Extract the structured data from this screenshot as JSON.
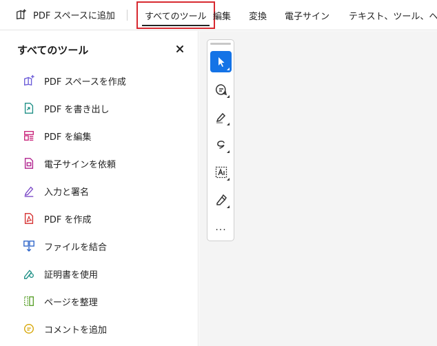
{
  "topbar": {
    "add_space_label": "PDF スペースに追加",
    "tabs": [
      {
        "label": "すべてのツール"
      },
      {
        "label": "編集"
      },
      {
        "label": "変換"
      },
      {
        "label": "電子サイン"
      },
      {
        "label": "テキスト、ツール、ヘルプ"
      }
    ],
    "highlight_color": "#d7282f"
  },
  "panel": {
    "title": "すべてのツール",
    "close_icon": "close-icon",
    "items": [
      {
        "label": "PDF スペースを作成",
        "icon": "pdf-space-create-icon",
        "color": "#6b5bd8"
      },
      {
        "label": "PDF を書き出し",
        "icon": "export-pdf-icon",
        "color": "#1d8f85"
      },
      {
        "label": "PDF を編集",
        "icon": "edit-pdf-icon",
        "color": "#c9237a"
      },
      {
        "label": "電子サインを依頼",
        "icon": "request-signature-icon",
        "color": "#b0238e"
      },
      {
        "label": "入力と署名",
        "icon": "fill-sign-icon",
        "color": "#7b49c7"
      },
      {
        "label": "PDF を作成",
        "icon": "create-pdf-icon",
        "color": "#d42d2d"
      },
      {
        "label": "ファイルを結合",
        "icon": "combine-files-icon",
        "color": "#2a62c8"
      },
      {
        "label": "証明書を使用",
        "icon": "certificate-icon",
        "color": "#1d8f85"
      },
      {
        "label": "ページを整理",
        "icon": "organize-pages-icon",
        "color": "#5aa02c"
      },
      {
        "label": "コメントを追加",
        "icon": "add-comment-icon",
        "color": "#d6a400"
      }
    ]
  },
  "quick_tools": {
    "selected_color": "#1473e6",
    "buttons": [
      {
        "icon": "select-cursor-icon"
      },
      {
        "icon": "comment-icon"
      },
      {
        "icon": "highlight-pen-icon"
      },
      {
        "icon": "freehand-draw-icon"
      },
      {
        "icon": "text-recognize-icon"
      },
      {
        "icon": "sign-pen-icon"
      },
      {
        "icon": "more-icon",
        "label": "..."
      }
    ]
  }
}
